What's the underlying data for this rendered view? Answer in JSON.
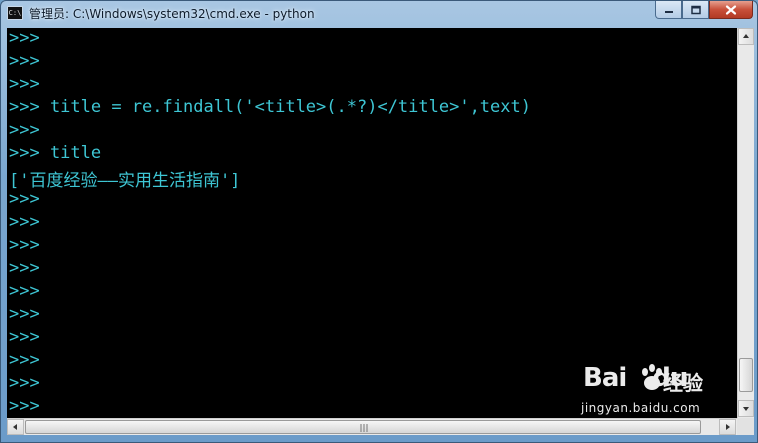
{
  "window": {
    "title": "管理员: C:\\Windows\\system32\\cmd.exe - python",
    "icon": "cmd-icon",
    "icon_text": "C:\\"
  },
  "console": {
    "lines": [
      ">>>",
      ">>>",
      ">>>",
      ">>> title = re.findall('<title>(.*?)</title>',text)",
      ">>>",
      ">>> title",
      "['百度经验——实用生活指南']",
      ">>>",
      ">>>",
      ">>>",
      ">>>",
      ">>>",
      ">>>",
      ">>>",
      ">>>",
      ">>>",
      ">>>"
    ],
    "text_color": "#3ec6d4",
    "background": "#000000"
  },
  "watermark": {
    "brand": "Bai",
    "brand_suffix": "du",
    "product": "经验",
    "url": "jingyan.baidu.com"
  },
  "scrollbars": {
    "vertical_position": 0.95
  }
}
